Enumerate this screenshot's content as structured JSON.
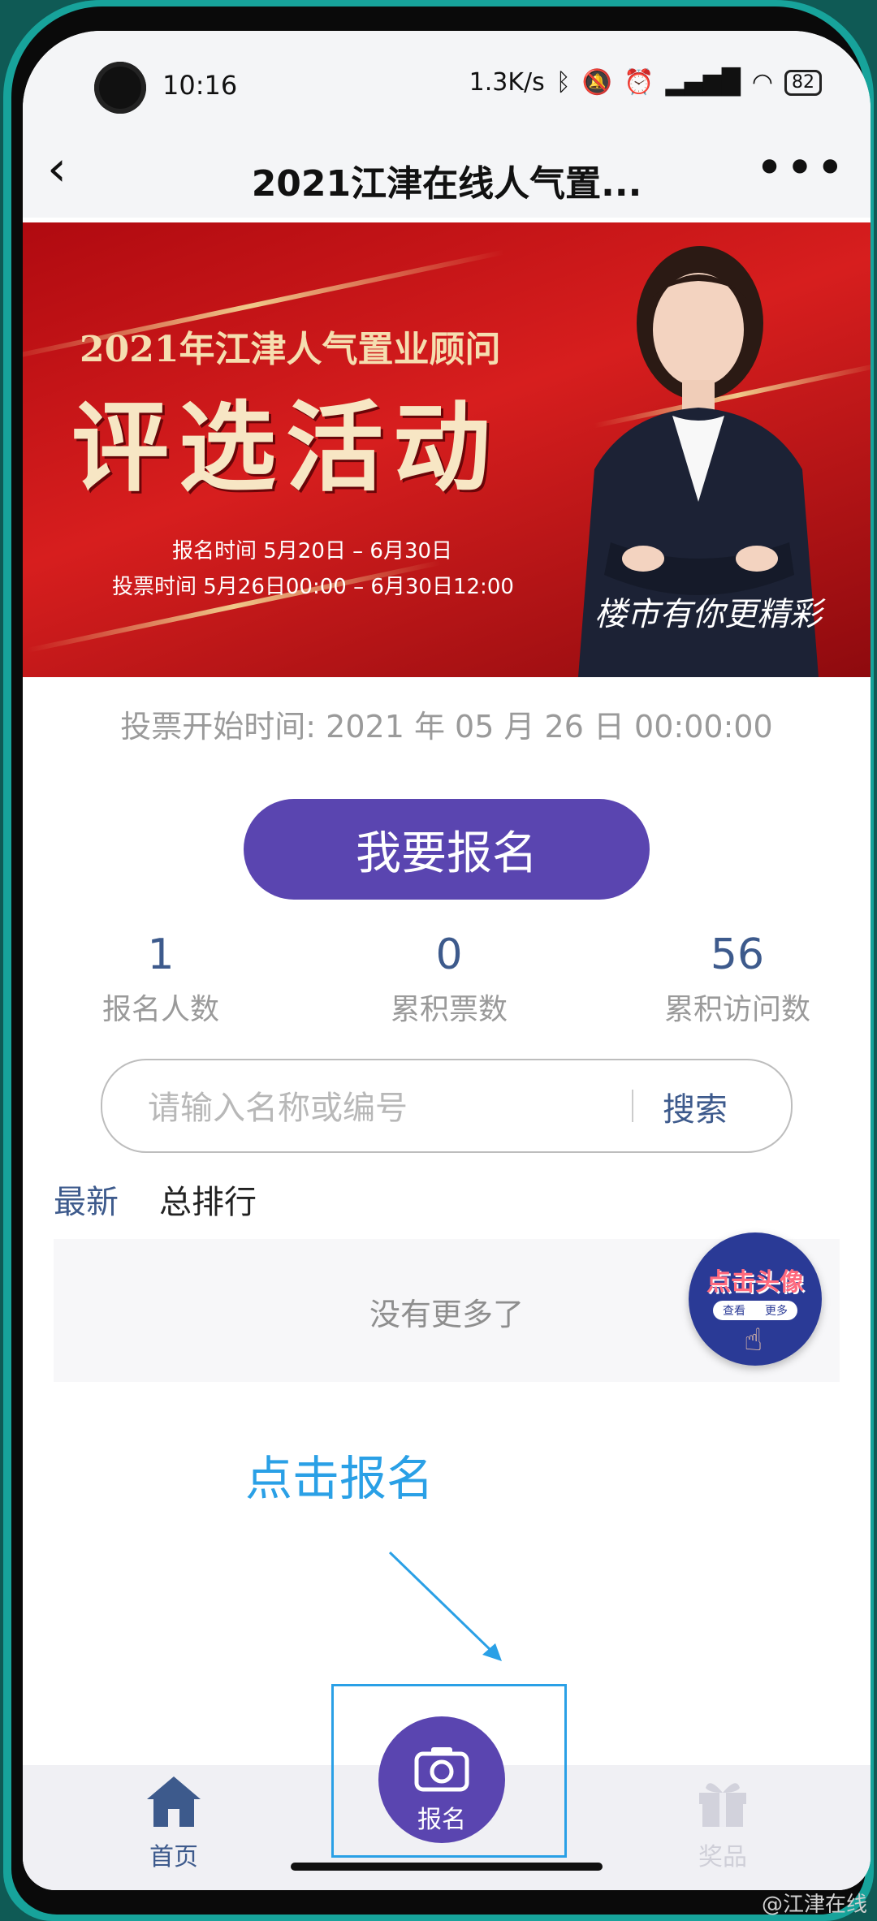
{
  "status_bar": {
    "time": "10:16",
    "net_speed": "1.3K/s",
    "battery": "82"
  },
  "nav": {
    "title": "2021江津在线人气置..."
  },
  "banner": {
    "subtitle": "2021年江津人气置业顾问",
    "title": "评选活动",
    "signup_time": "报名时间 5月20日 – 6月30日",
    "vote_time": "投票时间 5月26日00:00 – 6月30日12:00",
    "slogan": "楼市有你更精彩"
  },
  "vote_start": "投票开始时间: 2021 年 05 月 26 日  00:00:00",
  "signup_button": "我要报名",
  "stats": [
    {
      "value": "1",
      "label": "报名人数"
    },
    {
      "value": "0",
      "label": "累积票数"
    },
    {
      "value": "56",
      "label": "累积访问数"
    }
  ],
  "search": {
    "placeholder": "请输入名称或编号",
    "button": "搜索"
  },
  "tabs": {
    "latest": "最新",
    "ranking": "总排行"
  },
  "list": {
    "empty_text": "没有更多了"
  },
  "float_avatar": {
    "title": "点击头像",
    "left": "查看",
    "right": "更多"
  },
  "annotation": "点击报名",
  "tabbar": {
    "home": "首页",
    "signup": "报名",
    "prize": "奖品"
  },
  "watermark": "@江津在线",
  "colors": {
    "primary": "#5a45b0",
    "link": "#3d5a8c",
    "annotation": "#2aa0e6",
    "banner_red": "#d71e1e"
  }
}
